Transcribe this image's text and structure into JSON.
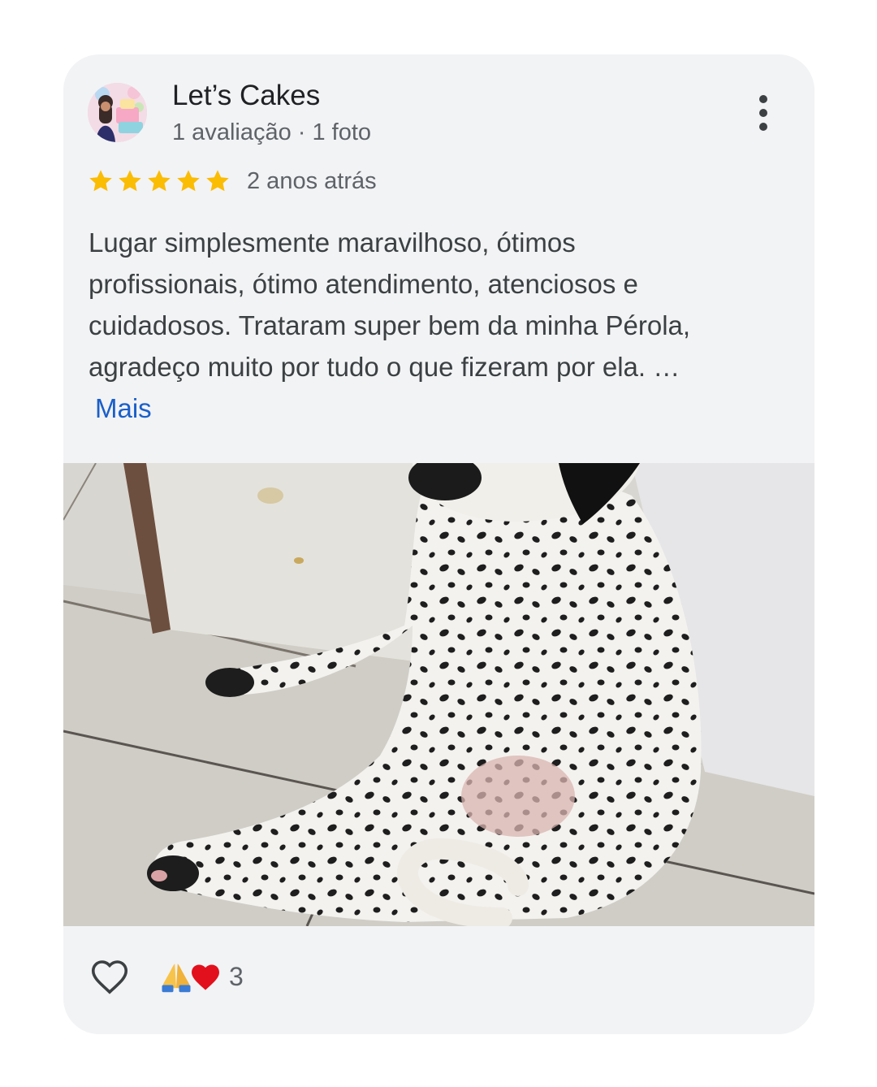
{
  "review": {
    "reviewer": {
      "name": "Let’s Cakes",
      "meta": "1 avaliação · 1 foto",
      "avatar": "reviewer-avatar-photo"
    },
    "rating": {
      "stars": 5,
      "max_stars": 5,
      "color": "#fbbc04"
    },
    "date": "2 anos atrás",
    "text_lines": [
      "Lugar simplesmente maravilhoso, ótimos",
      "profissionais, ótimo atendimento, atenciosos e",
      "cuidadosos. Trataram super bem da minha Pérola,",
      "agradeço muito por tudo o que fizeram por ela. …"
    ],
    "more_label": "Mais",
    "more_color": "#1a5fc9",
    "menu_icon": "more-vertical-icon",
    "photo": "dalmatian-puppy-photo"
  },
  "footer": {
    "like_icon": "heart-outline-icon",
    "reaction_icons": [
      "folded-hands-emoji",
      "red-heart-emoji"
    ],
    "reaction_count": "3"
  }
}
